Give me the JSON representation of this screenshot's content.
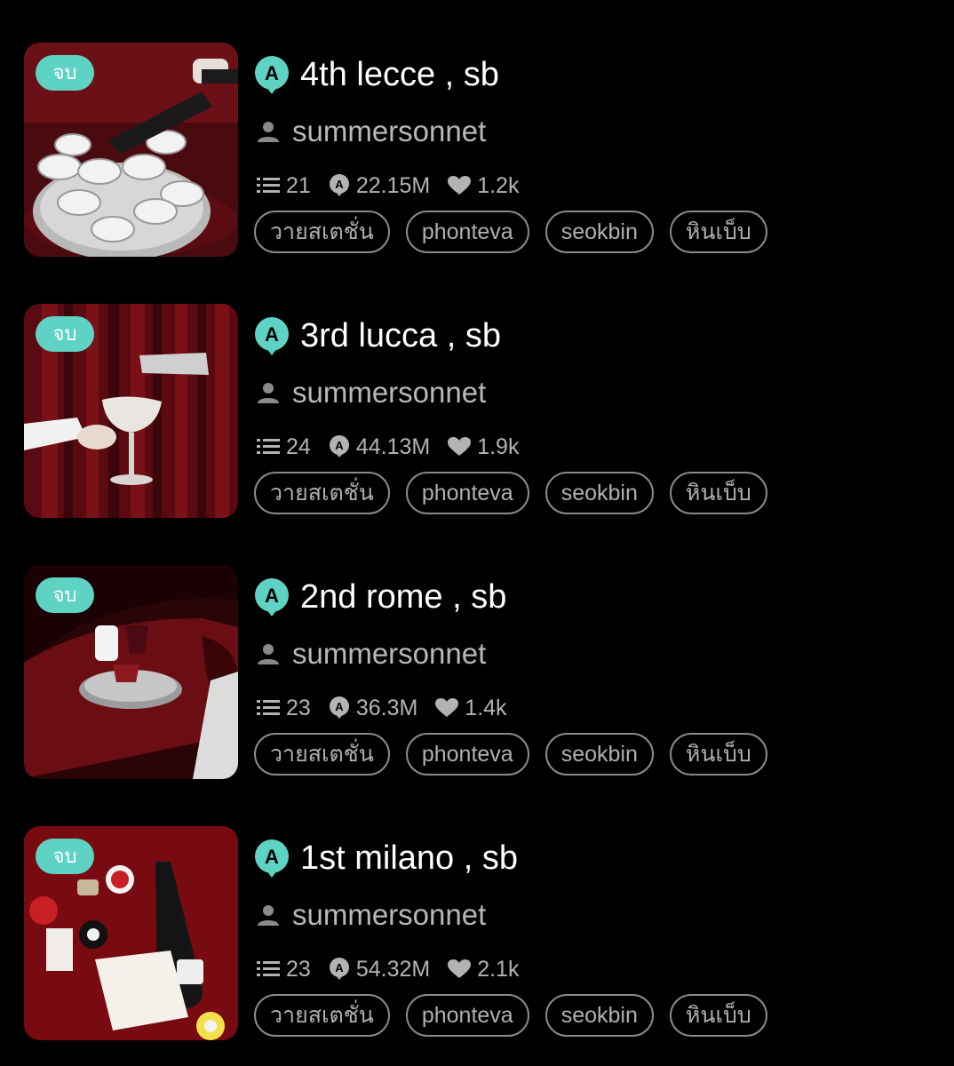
{
  "stories": [
    {
      "badge": "จบ",
      "title": "4th lecce , sb",
      "author": "summersonnet",
      "chapters": "21",
      "views": "22.15M",
      "likes": "1.2k",
      "tags": [
        "วายสเตชั่น",
        "phonteva",
        "seokbin",
        "หินเบ็บ"
      ]
    },
    {
      "badge": "จบ",
      "title": "3rd lucca , sb",
      "author": "summersonnet",
      "chapters": "24",
      "views": "44.13M",
      "likes": "1.9k",
      "tags": [
        "วายสเตชั่น",
        "phonteva",
        "seokbin",
        "หินเบ็บ"
      ]
    },
    {
      "badge": "จบ",
      "title": "2nd rome , sb",
      "author": "summersonnet",
      "chapters": "23",
      "views": "36.3M",
      "likes": "1.4k",
      "tags": [
        "วายสเตชั่น",
        "phonteva",
        "seokbin",
        "หินเบ็บ"
      ]
    },
    {
      "badge": "จบ",
      "title": "1st milano , sb",
      "author": "summersonnet",
      "chapters": "23",
      "views": "54.32M",
      "likes": "2.1k",
      "tags": [
        "วายสเตชั่น",
        "phonteva",
        "seokbin",
        "หินเบ็บ"
      ]
    }
  ],
  "colors": {
    "background": "#000000",
    "badge": "#5fd3c3",
    "accent_icon": "#5fd3c3",
    "meta_text": "#b3b3b3",
    "tag_border": "#8a8a8a"
  },
  "icons": {
    "status_badge": "complete-badge",
    "title": "app-a-logo-icon",
    "author": "user-icon",
    "chapters": "list-icon",
    "views": "views-a-icon",
    "likes": "heart-icon"
  }
}
